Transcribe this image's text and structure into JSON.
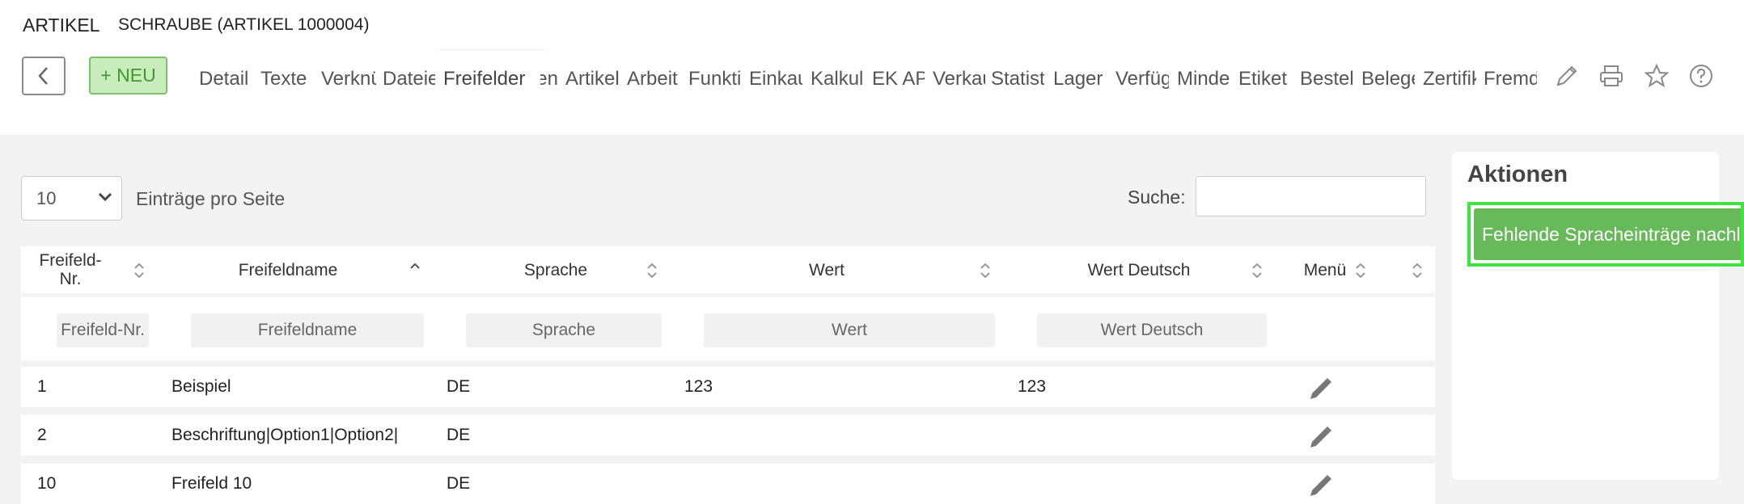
{
  "header": {
    "section": "ARTIKEL",
    "record": "SCHRAUBE (ARTIKEL 1000004)"
  },
  "toolbar": {
    "new_label": "+ NEU"
  },
  "tabs": [
    {
      "label": "Detail",
      "active": false
    },
    {
      "label": "Texte",
      "active": false
    },
    {
      "label": "Verknüpfungen",
      "active": false
    },
    {
      "label": "Dateien",
      "active": false
    },
    {
      "label": "Freifelder",
      "active": true
    },
    {
      "label": "Sprachen",
      "active": false
    },
    {
      "label": "Artikel",
      "active": false
    },
    {
      "label": "Arbeit",
      "active": false
    },
    {
      "label": "Funktionen",
      "active": false
    },
    {
      "label": "Einkauf",
      "active": false
    },
    {
      "label": "Kalkulation",
      "active": false
    },
    {
      "label": "EK AP",
      "active": false
    },
    {
      "label": "Verkauf",
      "active": false
    },
    {
      "label": "Statistik",
      "active": false
    },
    {
      "label": "Lager",
      "active": false
    },
    {
      "label": "Verfügbarkeit",
      "active": false
    },
    {
      "label": "Mindestbestand",
      "active": false
    },
    {
      "label": "Etiket",
      "active": false
    },
    {
      "label": "Bestellungen",
      "active": false
    },
    {
      "label": "Belege",
      "active": false
    },
    {
      "label": "Zertifikate",
      "active": false
    },
    {
      "label": "Fremdartikel",
      "active": false
    }
  ],
  "table_controls": {
    "page_size": "10",
    "page_size_label": "Einträge pro Seite",
    "search_label": "Suche:",
    "search_value": ""
  },
  "columns": [
    "Freifeld-Nr.",
    "Freifeldname",
    "Sprache",
    "Wert",
    "Wert Deutsch",
    "Menü"
  ],
  "filters": {
    "nr": "Freifeld-Nr.",
    "name": "Freifeldname",
    "sprache": "Sprache",
    "wert": "Wert",
    "wert_de": "Wert Deutsch"
  },
  "rows": [
    {
      "nr": "1",
      "name": "Beispiel",
      "sprache": "DE",
      "wert": "123",
      "wert_de": "123"
    },
    {
      "nr": "2",
      "name": "Beschriftung|Option1|Option2|",
      "sprache": "DE",
      "wert": "",
      "wert_de": ""
    },
    {
      "nr": "10",
      "name": "Freifeld 10",
      "sprache": "DE",
      "wert": "",
      "wert_de": ""
    }
  ],
  "actions": {
    "title": "Aktionen",
    "button": "Fehlende Spracheinträge nachladen"
  },
  "colors": {
    "accent_green": "#67b95a",
    "highlight": "#3ee33e",
    "new_bg": "#c9ecbd"
  }
}
